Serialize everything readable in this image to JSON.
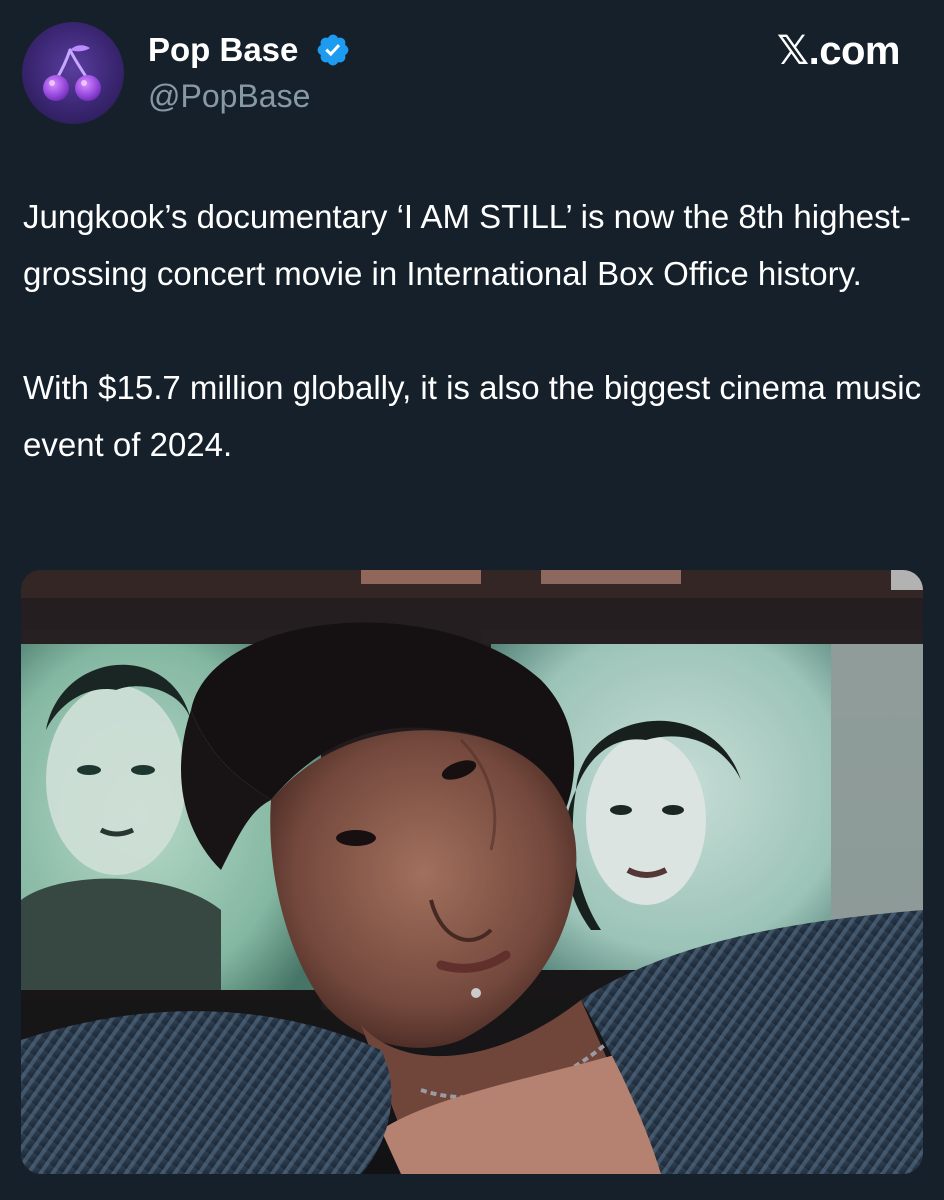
{
  "tweet": {
    "author": {
      "name": "Pop Base",
      "handle": "@PopBase",
      "verified": true,
      "avatar_icon": "cherry-icon"
    },
    "source_logo": "𝕏.com",
    "text": {
      "paragraph_1": "Jungkook’s documentary ‘I AM STILL’ is now the 8th highest-grossing concert movie in International Box Office history.",
      "paragraph_2": "With $15.7 million globally, it is also the biggest cinema music event of 2024."
    },
    "media": {
      "kind": "photo"
    }
  },
  "colors": {
    "background": "#15202b",
    "text_primary": "#ffffff",
    "text_secondary": "#8899a6",
    "verified_blue": "#1d9bf0"
  }
}
